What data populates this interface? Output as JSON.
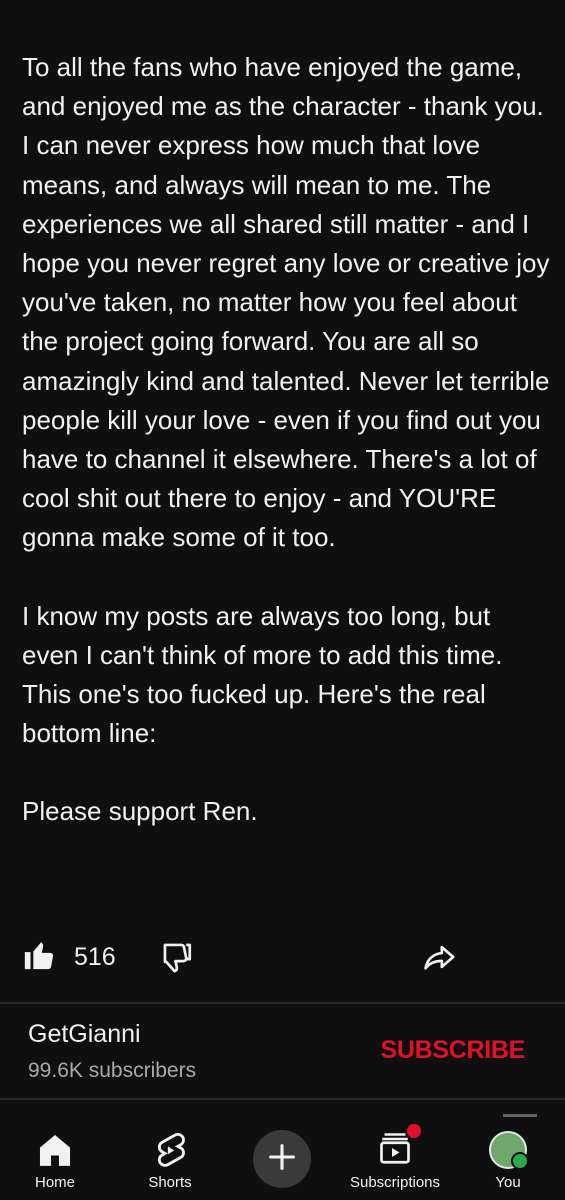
{
  "post": {
    "paragraphs": [
      "To all the fans who have enjoyed the game, and enjoyed me as the character - thank you. I can never express how much that love means, and always will mean to me. The experiences we all shared still matter - and I hope you never regret any love or creative joy you've taken, no matter how you feel about the project going forward. You are all so amazingly kind and talented. Never let terrible people kill your love - even if you find out you have to channel it elsewhere. There's a lot of cool shit out there to enjoy - and YOU'RE gonna make some of it too.",
      "I know my posts are always too long, but even I can't think of more to add this time. This one's too fucked up. Here's the real bottom line:",
      "Please support Ren."
    ]
  },
  "actions": {
    "like_count": "516"
  },
  "channel": {
    "name": "GetGianni",
    "subscribers": "99.6K subscribers",
    "subscribe_label": "SUBSCRIBE"
  },
  "nav": {
    "home": "Home",
    "shorts": "Shorts",
    "subscriptions": "Subscriptions",
    "you": "You"
  },
  "colors": {
    "background": "#0f0f0f",
    "text": "#f1f1f1",
    "subscribe": "#e0102a",
    "muted": "#aaaaaa"
  },
  "icons": [
    "like-icon",
    "dislike-icon",
    "share-icon",
    "home-icon",
    "shorts-icon",
    "create-icon",
    "subscriptions-icon",
    "avatar"
  ]
}
